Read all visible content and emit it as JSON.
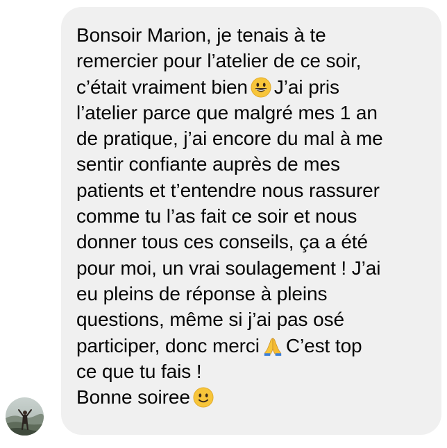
{
  "message": {
    "lines": [
      "Bonsoir Marion, je tenais à te",
      "remercier pour l’atelier de ce soir,",
      "c’était vraiment bien",
      "J’ai pris",
      "l’atelier parce que malgré mes 1 an",
      "de pratique, j’ai encore du mal à me",
      "sentir confiante auprès de mes",
      "patients et t’entendre nous rassurer",
      "comme tu l’as fait ce soir et nous",
      "donner tous ces conseils, ça a été",
      "pour moi, un vrai soulagement ! J’ai",
      "eu pleins de réponse à pleins",
      "questions, même si j’ai pas osé",
      "participer, donc merci",
      "C’est top",
      "ce que tu fais !",
      "Bonne soiree"
    ],
    "emojis": {
      "grinning": "grinning-face-emoji",
      "pray": "folded-hands-emoji",
      "smile": "slightly-smiling-face-emoji"
    },
    "colors": {
      "bubble": "#f0f0f0",
      "text": "#050505",
      "emoji_yellow": "#f7c53a"
    }
  },
  "sender": {
    "avatar_icon": "avatar"
  }
}
